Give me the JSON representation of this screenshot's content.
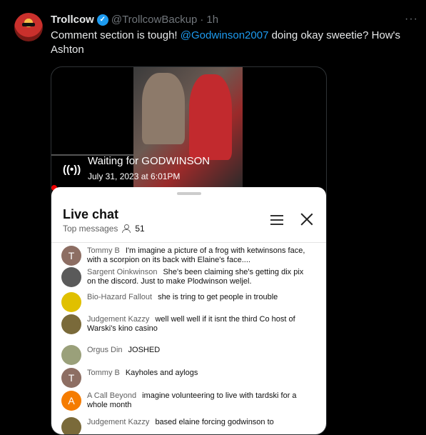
{
  "tweet": {
    "name": "Trollcow",
    "handle": "@TrollcowBackup",
    "dot": "·",
    "time": "1h",
    "text_before": "Comment section is tough! ",
    "mention": "@Godwinson2007",
    "text_after": " doing okay sweetie? How's Ashton",
    "more": "···"
  },
  "video": {
    "title": "Waiting for GODWINSON",
    "date": "July 31, 2023 at 6:01PM"
  },
  "livechat": {
    "title": "Live chat",
    "subtitle": "Top messages",
    "viewer_count": "51",
    "messages": [
      {
        "initial": "T",
        "avatar_color": "#8d6e63",
        "author": "Tommy B",
        "text": "I'm imagine a picture of a frog with ketwinsons face, with a scorpion on its back with Elaine's face...."
      },
      {
        "initial": "",
        "avatar_color": "#5a5a5a",
        "author": "Sargent Oinkwinson",
        "text": "She's been claiming she's getting dix pix on the discord. Just to make Plodwinson weljel."
      },
      {
        "initial": "",
        "avatar_color": "#e0c000",
        "author": "Bio-Hazard Fallout",
        "text": "she is tring to get people in trouble"
      },
      {
        "initial": "",
        "avatar_color": "#7a6a3a",
        "author": "Judgement Kazzy",
        "text": "well well well if it isnt the third Co host of Warski's kino casino"
      },
      {
        "initial": "",
        "avatar_color": "#9aa07a",
        "author": "Orgus Din",
        "text": "JOSHED"
      },
      {
        "initial": "T",
        "avatar_color": "#8d6e63",
        "author": "Tommy B",
        "text": "Kayholes and aylogs"
      },
      {
        "initial": "A",
        "avatar_color": "#f57c00",
        "author": "A Call Beyond",
        "text": "imagine volunteering to live with tardski for a whole month"
      },
      {
        "initial": "",
        "avatar_color": "#7a6a3a",
        "author": "Judgement Kazzy",
        "text": "based elaine forcing godwinson to"
      }
    ]
  }
}
